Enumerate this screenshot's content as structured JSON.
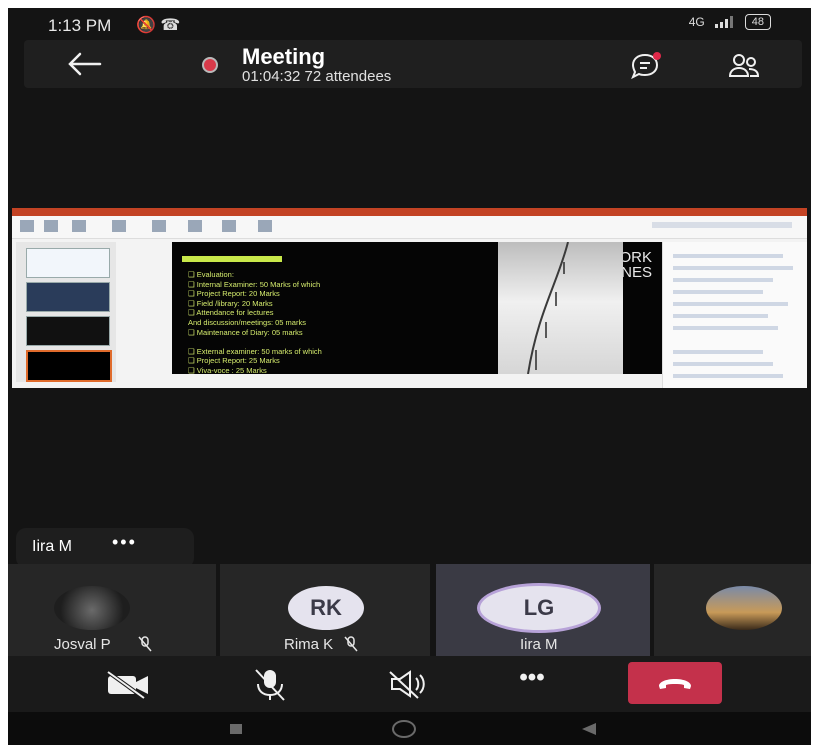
{
  "status_bar": {
    "time": "1:13 PM",
    "icons": "🔕 ☎",
    "network": "4G",
    "battery": "48"
  },
  "header": {
    "title": "Meeting",
    "subtitle": "01:04:32 72 attendees",
    "recording_color": "#d83a4a"
  },
  "shared_content": {
    "slide_title_line1": "PROJECT WORK",
    "slide_title_line2": "GUIDELINES",
    "slide_lines": [
      "❑ Evaluation:",
      "❑ Internal Examiner: 50 Marks of which",
      "❑ Project Report: 20 Marks",
      "❑ Field /library: 20 Marks",
      "❑ Attendance for lectures",
      "And discussion/meetings: 05 marks",
      "❑ Maintenance of Diary: 05 marks",
      "",
      "❑ External examiner: 50 marks of which",
      "❑ Project Report: 25 Marks",
      "❑ Viva-voce : 25 Marks"
    ]
  },
  "self_view": {
    "name": "Iira M",
    "more": "•••"
  },
  "participants": [
    {
      "name": "Josval P",
      "initials": "",
      "muted": true
    },
    {
      "name": "Rima K",
      "initials": "RK",
      "muted": true
    },
    {
      "name": "Iira M",
      "initials": "LG",
      "muted": false,
      "active": true
    }
  ],
  "controls": {
    "more": "•••",
    "hangup_color": "#c4314b"
  }
}
